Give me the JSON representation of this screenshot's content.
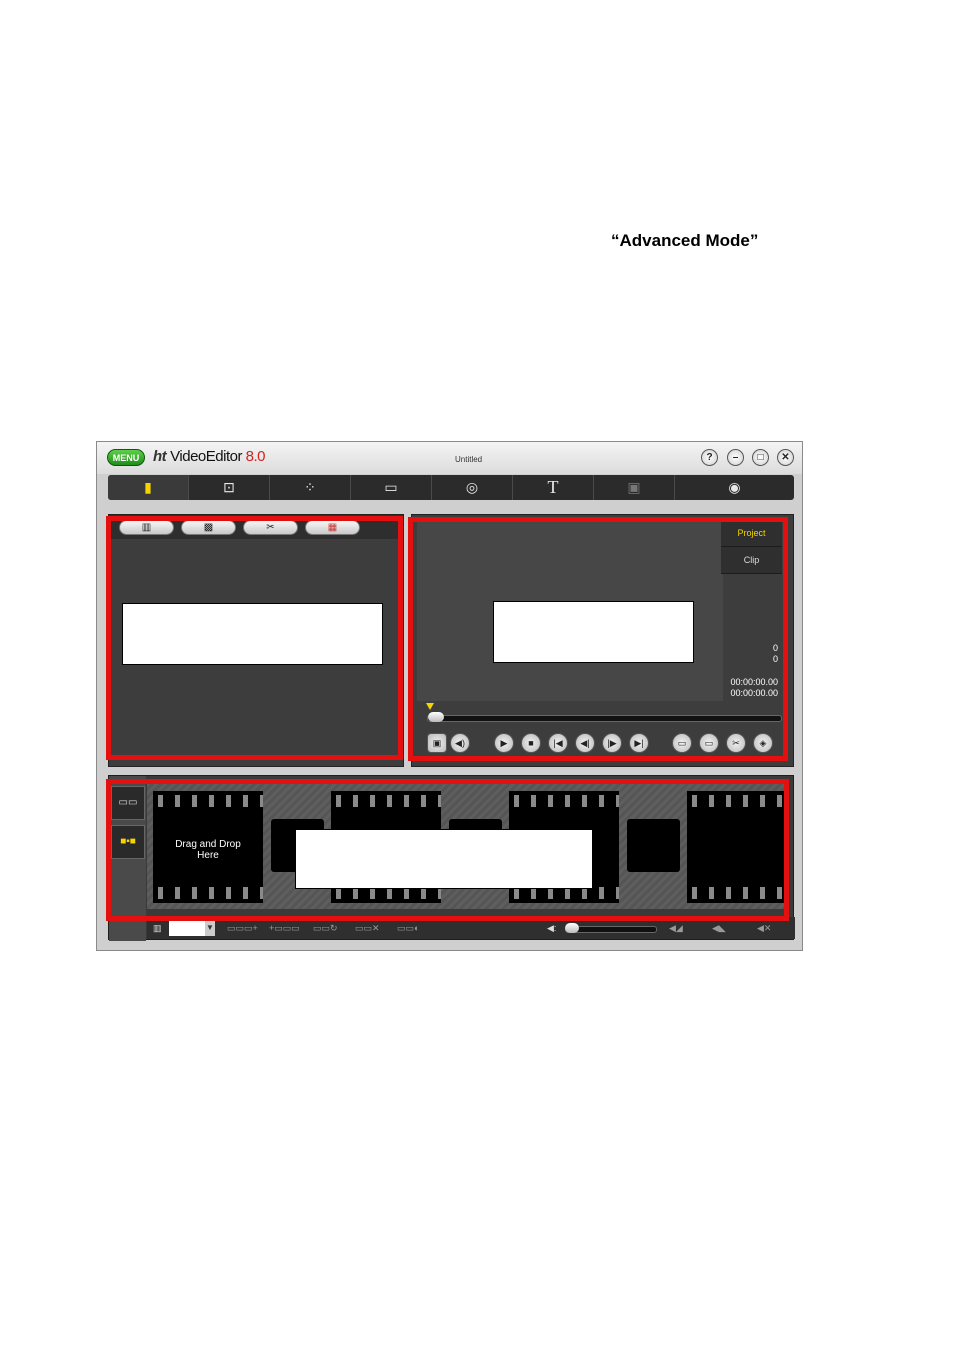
{
  "document": {
    "heading": "“Advanced Mode”"
  },
  "titlebar": {
    "menu_label": "MENU",
    "logo_ht": "ht",
    "logo_name": "VideoEditor",
    "logo_version": "8.0",
    "doc_title": "Untitled",
    "help_label": "?",
    "minimize_label": "–",
    "maximize_label": "□",
    "close_label": "✕"
  },
  "toolbar": {
    "items": [
      {
        "icon": "new-project-icon",
        "glyph": "▮"
      },
      {
        "icon": "capture-icon",
        "glyph": "⊡"
      },
      {
        "icon": "effects-wand-icon",
        "glyph": "⁘"
      },
      {
        "icon": "transition-icon",
        "glyph": "▭"
      },
      {
        "icon": "globe-icon",
        "glyph": "◎"
      },
      {
        "icon": "text-icon",
        "glyph": "T"
      },
      {
        "icon": "save-disk-icon",
        "glyph": "▣"
      },
      {
        "icon": "burn-disc-icon",
        "glyph": "◉"
      }
    ]
  },
  "library": {
    "tabs": [
      {
        "icon": "filmstrip-icon",
        "glyph": "▥"
      },
      {
        "icon": "photo-icon",
        "glyph": "▩"
      },
      {
        "icon": "transitions-icon",
        "glyph": "✂"
      },
      {
        "icon": "color-grid-icon",
        "glyph": "▦"
      }
    ]
  },
  "preview": {
    "project_tab": "Project",
    "clip_tab": "Clip",
    "counter_a": "0",
    "counter_b": "0",
    "time_current": "00:00:00.00",
    "time_total": "00:00:00.00",
    "controls": {
      "snapshot": "▣",
      "volume": "◀)",
      "play": "▶",
      "stop": "■",
      "start": "|◀",
      "prev_frame": "◀|",
      "next_frame": "|▶",
      "end": "▶|",
      "mark_in": "▭",
      "mark_out": "▭",
      "cut": "✂",
      "erase": "◈"
    }
  },
  "timeline": {
    "mode_ruler": "▭▭",
    "mode_storyboard": "■▪■",
    "drop_text_line1": "Drag and Drop",
    "drop_text_line2": "Here",
    "bottom": {
      "zoom_icon": "▥",
      "zoom_arrow": "▼",
      "btn1": "▭▭▭+",
      "btn2": "+▭▭▭",
      "btn3": "▭▭↻",
      "btn4": "▭▭✕",
      "btn5": "▭▭◐",
      "speaker": "◀:",
      "fade_in": "◀◢",
      "fade_out": "◀◣",
      "mute": "◀✕"
    }
  },
  "colors": {
    "highlight_red": "#e41010",
    "accent_yellow": "#f5d400",
    "menu_green": "#2fae25"
  }
}
